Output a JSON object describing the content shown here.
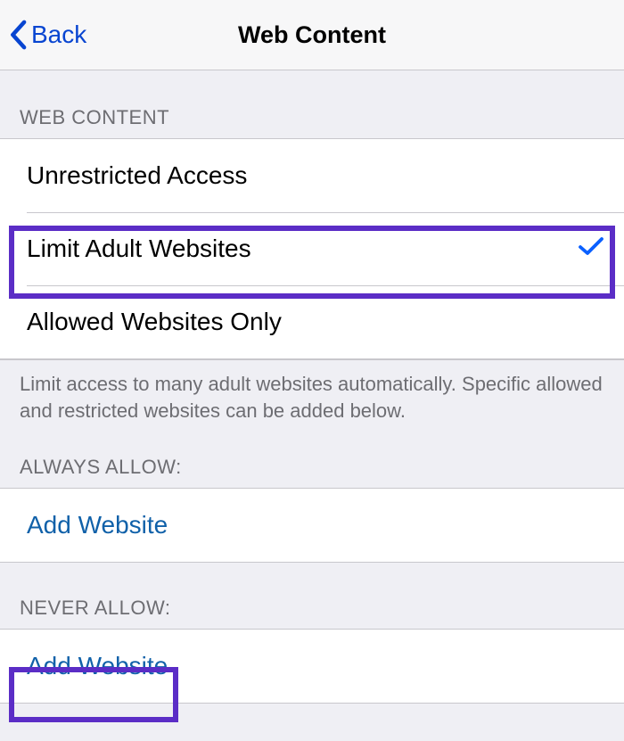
{
  "nav": {
    "back_label": "Back",
    "title": "Web Content"
  },
  "sections": {
    "web_content_header": "WEB CONTENT",
    "options": {
      "unrestricted": "Unrestricted Access",
      "limit_adult": "Limit Adult Websites",
      "allowed_only": "Allowed Websites Only"
    },
    "footer_text": "Limit access to many adult websites automatically. Specific allowed and restricted websites can be added below.",
    "always_allow_header": "ALWAYS ALLOW:",
    "always_allow_add": "Add Website",
    "never_allow_header": "NEVER ALLOW:",
    "never_allow_add": "Add Website"
  }
}
